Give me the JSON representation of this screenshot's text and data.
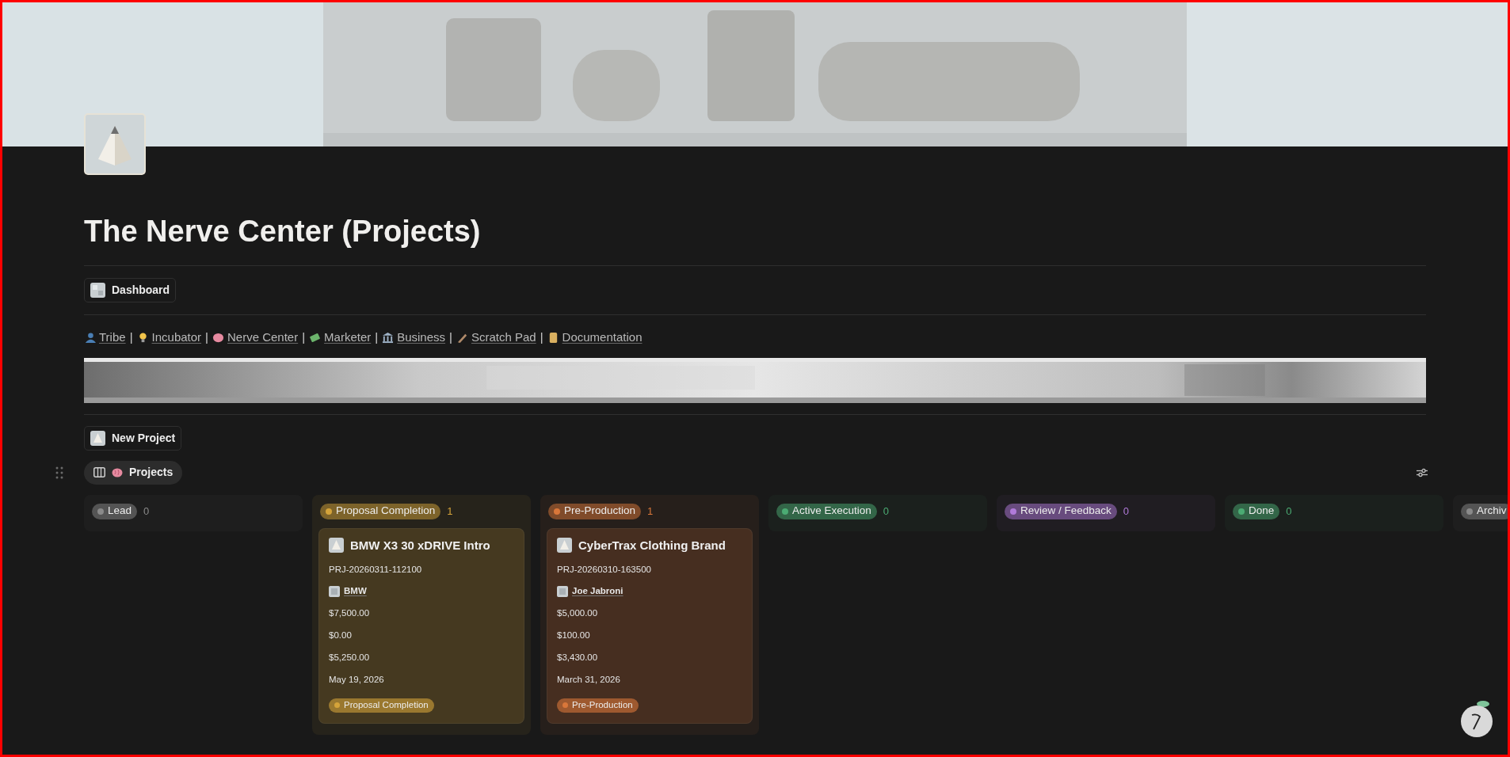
{
  "page": {
    "title": "The Nerve Center (Projects)"
  },
  "dashboard_button": {
    "label": "Dashboard"
  },
  "nav_links": [
    {
      "label": "Tribe",
      "separator": "|"
    },
    {
      "label": "Incubator",
      "separator": "|"
    },
    {
      "label": "Nerve Center",
      "separator": "|"
    },
    {
      "label": "Marketer",
      "separator": "|"
    },
    {
      "label": "Business",
      "separator": "|"
    },
    {
      "label": "Scratch Pad",
      "separator": "|"
    },
    {
      "label": "Documentation"
    }
  ],
  "new_project_button": {
    "label": "New Project"
  },
  "view_tab": {
    "label": "Projects",
    "selected": true
  },
  "board": {
    "columns": [
      {
        "name": "Lead",
        "count": "0",
        "color": "#8a8a8a"
      },
      {
        "name": "Proposal Completion",
        "count": "1",
        "color": "#d4a33a",
        "cards": [
          {
            "title": "BMW X3 30 xDRIVE Intro",
            "project_id": "PRJ-20260311-112100",
            "client": "BMW",
            "amount_1": "$7,500.00",
            "amount_2": "$0.00",
            "amount_3": "$5,250.00",
            "date": "May 19, 2026",
            "status": "Proposal Completion"
          }
        ]
      },
      {
        "name": "Pre-Production",
        "count": "1",
        "color": "#d9773a",
        "cards": [
          {
            "title": "CyberTrax Clothing Brand",
            "project_id": "PRJ-20260310-163500",
            "client": "Joe Jabroni",
            "amount_1": "$5,000.00",
            "amount_2": "$100.00",
            "amount_3": "$3,430.00",
            "date": "March 31, 2026",
            "status": "Pre-Production"
          }
        ]
      },
      {
        "name": "Active Execution",
        "count": "0",
        "color": "#4bab73"
      },
      {
        "name": "Review / Feedback",
        "count": "0",
        "color": "#b07ad9"
      },
      {
        "name": "Done",
        "count": "0",
        "color": "#4bab73"
      },
      {
        "name": "Archiv",
        "color": "#8a8a8a"
      }
    ]
  }
}
